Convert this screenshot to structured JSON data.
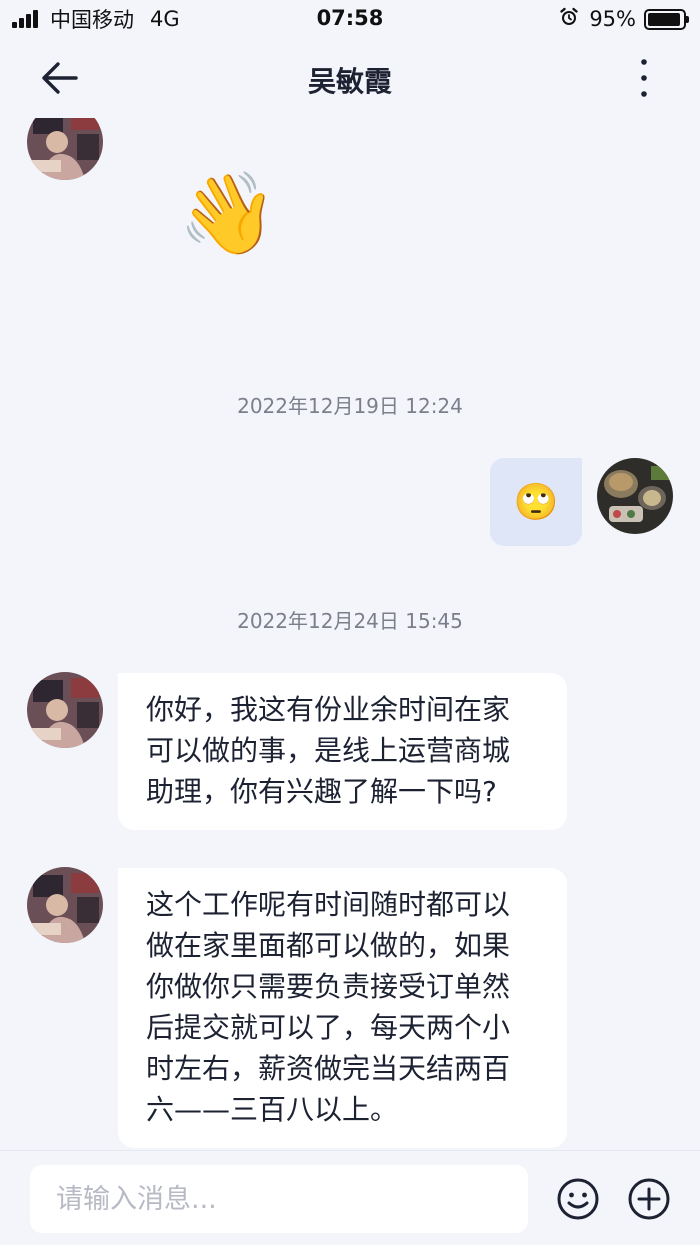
{
  "status_bar": {
    "carrier": "中国移动",
    "network": "4G",
    "time": "07:58",
    "battery": "95%",
    "battery_level": 0.95
  },
  "header": {
    "title": "吴敏霞",
    "back_icon": "arrow-left-icon",
    "more_icon": "more-vertical-icon"
  },
  "messages": [
    {
      "from": "contact",
      "type": "emoji",
      "content": "👋"
    },
    {
      "type": "timestamp",
      "text": "2022年12月19日 12:24"
    },
    {
      "from": "me",
      "type": "emoji",
      "content": "🙄"
    },
    {
      "type": "timestamp",
      "text": "2022年12月24日 15:45"
    },
    {
      "from": "contact",
      "type": "text",
      "lines": [
        "你好，我这有份业余时间在家",
        "可以做的事，是线上运营商城",
        "助理，你有兴趣了解一下吗?"
      ]
    },
    {
      "from": "contact",
      "type": "text",
      "lines": [
        "这个工作呢有时间随时都可以",
        "做在家里面都可以做的，如果",
        "你做你只需要负责接受订单然",
        "后提交就可以了，每天两个小",
        "时左右，薪资做完当天结两百",
        "六——三百八以上。"
      ]
    }
  ],
  "input": {
    "placeholder": "请输入消息...",
    "value": "",
    "emoji_icon": "smiley-icon",
    "add_icon": "plus-circle-icon"
  },
  "colors": {
    "background": "#f4f5fa",
    "outgoing_bubble": "#dfe6f8",
    "incoming_bubble": "#ffffff",
    "text": "#1d2233",
    "timestamp": "#7b7f8c"
  }
}
